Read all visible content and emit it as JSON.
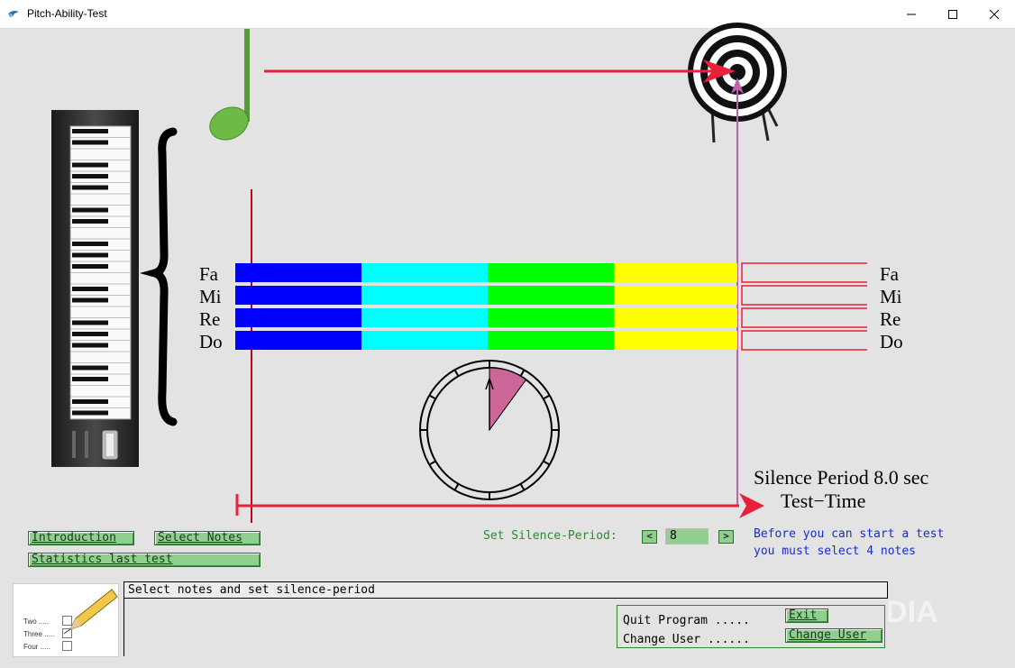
{
  "window": {
    "title": "Pitch-Ability-Test"
  },
  "notes_left": [
    "Fa",
    "Mi",
    "Re",
    "Do"
  ],
  "notes_right": [
    "Fa",
    "Mi",
    "Re",
    "Do"
  ],
  "bar_colors": [
    "#0000ff",
    "#00ffff",
    "#00ff00",
    "#ffff00"
  ],
  "silence_text": "Silence Period 8.0 sec",
  "test_time_label": "Test−Time",
  "buttons": {
    "introduction": "Introduction",
    "select_notes": "Select Notes",
    "statistics": "Statistics last test"
  },
  "silence_period": {
    "label": "Set Silence-Period:",
    "decrease": "<",
    "increase": ">",
    "value": "8"
  },
  "info": {
    "line1": "Before you can start a test",
    "line2": "you must select 4 notes"
  },
  "status": "Select notes and set silence-period",
  "quit_panel": {
    "quit_label": "Quit Program .....",
    "exit_button": "Exit",
    "change_label": "Change User ......",
    "change_button": "Change User"
  },
  "thumbnail": {
    "items": [
      "Two .....",
      "Three .....",
      "Four ....."
    ]
  },
  "watermark": "SOFTPEDIA",
  "clock": {
    "sector_fraction": 0.1
  }
}
